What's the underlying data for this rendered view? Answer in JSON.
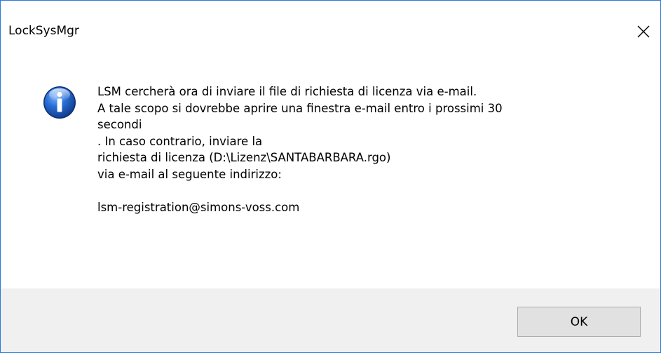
{
  "window": {
    "title": "LockSysMgr"
  },
  "dialog": {
    "icon": "info-icon",
    "message_lines": [
      "LSM cercherà ora di inviare il file di richiesta di licenza via e-mail.",
      "A tale scopo si dovrebbe aprire una finestra e-mail entro i prossimi 30",
      "secondi",
      ". In caso contrario, inviare la",
      "richiesta di licenza (D:\\Lizenz\\SANTABARBARA.rgo)",
      "via e-mail al seguente indirizzo:",
      "",
      "lsm-registration@simons-voss.com"
    ],
    "ok_label": "OK"
  },
  "colors": {
    "window_border": "#2b79d7",
    "footer_bg": "#f0f0f0",
    "button_bg": "#e1e1e1",
    "button_border": "#adadad",
    "icon_blue": "#1f5fc6"
  }
}
